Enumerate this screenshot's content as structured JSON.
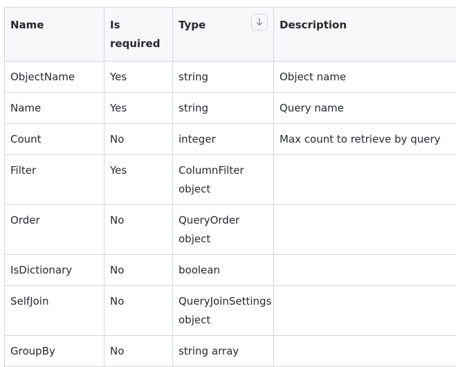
{
  "table": {
    "headers": {
      "name": "Name",
      "required": "Is required",
      "type": "Type",
      "description": "Description"
    },
    "sort_icon": "arrow-down-icon",
    "rows": [
      {
        "name": "ObjectName",
        "required": "Yes",
        "type": "string",
        "description": "Object name"
      },
      {
        "name": "Name",
        "required": "Yes",
        "type": "string",
        "description": "Query name"
      },
      {
        "name": "Count",
        "required": "No",
        "type": "integer",
        "description": "Max count to retrieve by query"
      },
      {
        "name": "Filter",
        "required": "Yes",
        "type": "ColumnFilter object",
        "description": ""
      },
      {
        "name": "Order",
        "required": "No",
        "type": "QueryOrder object",
        "description": ""
      },
      {
        "name": "IsDictionary",
        "required": "No",
        "type": "boolean",
        "description": ""
      },
      {
        "name": "SelfJoin",
        "required": "No",
        "type": "QueryJoinSettings object",
        "description": ""
      },
      {
        "name": "GroupBy",
        "required": "No",
        "type": "string array",
        "description": ""
      }
    ]
  }
}
